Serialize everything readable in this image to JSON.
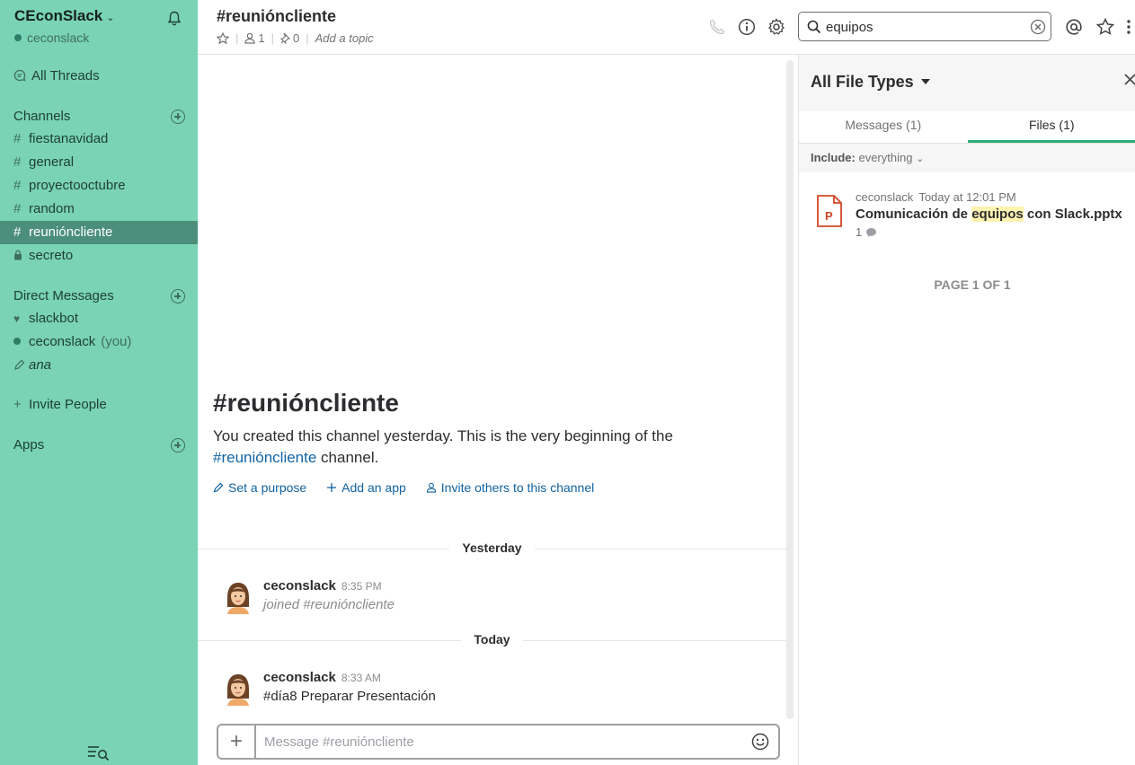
{
  "sidebar": {
    "team_name": "CEconSlack",
    "user_name": "ceconslack",
    "all_threads": "All Threads",
    "channels_heading": "Channels",
    "channels": [
      "fiestanavidad",
      "general",
      "proyectooctubre",
      "random",
      "reunióncliente",
      "secreto"
    ],
    "dm_heading": "Direct Messages",
    "dms": {
      "slackbot": "slackbot",
      "self": "ceconslack",
      "self_suffix": "(you)",
      "ana": "ana"
    },
    "invite_people": "Invite People",
    "apps_heading": "Apps"
  },
  "header": {
    "channel_title": "#reunióncliente",
    "member_count": "1",
    "pinned_count": "0",
    "topic_placeholder": "Add a topic",
    "search_value": "equipos"
  },
  "main": {
    "intro_title": "#reunióncliente",
    "intro_text_prefix": "You created this channel yesterday. This is the very beginning of the",
    "intro_channel_link": "#reunióncliente",
    "intro_text_suffix": "channel.",
    "actions": {
      "set_purpose": "Set a purpose",
      "add_app": "Add an app",
      "invite": "Invite others to this channel"
    },
    "divider_yesterday": "Yesterday",
    "divider_today": "Today",
    "messages": [
      {
        "author": "ceconslack",
        "time": "8:35 PM",
        "text": "joined #reunióncliente"
      },
      {
        "author": "ceconslack",
        "time": "8:33 AM",
        "text": "#día8 Preparar Presentación"
      }
    ],
    "composer_placeholder": "Message #reunióncliente"
  },
  "panel": {
    "title": "All File Types",
    "tab_messages": "Messages (1)",
    "tab_files": "Files (1)",
    "include_label": "Include:",
    "include_value": "everything",
    "result": {
      "user": "ceconslack",
      "time": "Today at 12:01 PM",
      "name_prefix": "Comunicación de",
      "name_highlight": "equipos",
      "name_suffix": "con Slack.pptx",
      "file_badge": "P",
      "comment_count": "1"
    },
    "page_label": "PAGE 1 OF 1"
  },
  "colors": {
    "sidebar_bg": "#79d3b4",
    "sidebar_active": "#4b8e7c",
    "link": "#1264a3",
    "tab_accent": "#2bac76",
    "pptx": "#d24726",
    "highlight": "#fff3b0"
  }
}
